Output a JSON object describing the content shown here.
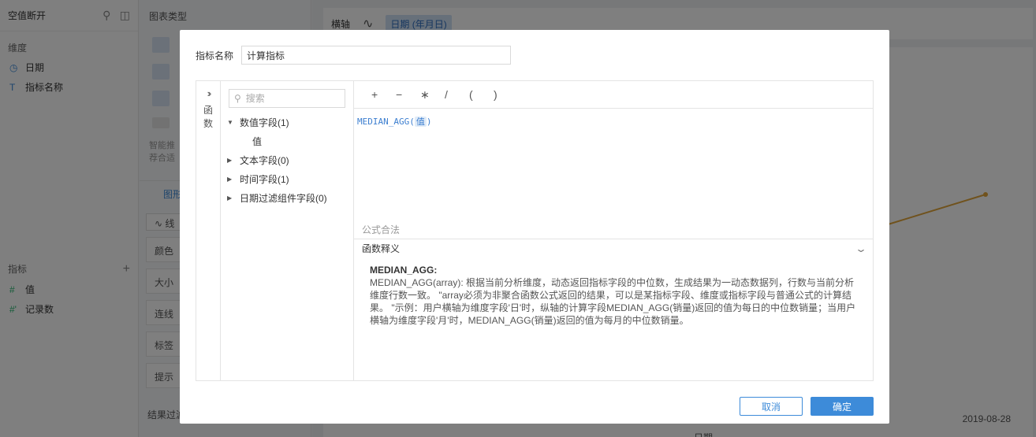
{
  "left_panel": {
    "title": "空值断开",
    "dimension_label": "维度",
    "dimensions": [
      {
        "icon": "clock-icon",
        "label": "日期"
      },
      {
        "icon": "text-type-icon",
        "label": "指标名称"
      }
    ],
    "metric_label": "指标",
    "metrics": [
      {
        "icon": "number-type-icon",
        "label": "值"
      },
      {
        "icon": "count-type-icon",
        "label": "记录数"
      }
    ]
  },
  "mid_panel": {
    "title": "图表类型",
    "smart_text_1": "智能推",
    "smart_text_2": "荐合适",
    "tab_label": "图形",
    "line_label": "线",
    "props": [
      "颜色",
      "大小",
      "连线",
      "标签",
      "提示"
    ],
    "filter_label": "结果过滤"
  },
  "main": {
    "axis_label": "横轴",
    "axis_chip": "日期 (年月日)",
    "date_tick": "2019-08-28",
    "x_title": "日期"
  },
  "modal": {
    "name_label": "指标名称",
    "name_value": "计算指标",
    "fn_label_1": "函",
    "fn_label_2": "数",
    "search_placeholder": "搜索",
    "tree": [
      {
        "label": "数值字段(1)",
        "expanded": true,
        "children": [
          "值"
        ]
      },
      {
        "label": "文本字段(0)",
        "expanded": false
      },
      {
        "label": "时间字段(1)",
        "expanded": false
      },
      {
        "label": "日期过滤组件字段(0)",
        "expanded": false
      }
    ],
    "operators": [
      "+",
      "−",
      "∗",
      "/",
      "(",
      ")"
    ],
    "formula_fn": "MEDIAN_AGG(",
    "formula_arg": "值",
    "formula_close": ")",
    "valid_text": "公式合法",
    "explain_label": "函数释义",
    "explain_title": "MEDIAN_AGG:",
    "explain_body": "MEDIAN_AGG(array): 根据当前分析维度，动态返回指标字段的中位数，生成结果为一动态数据列，行数与当前分析维度行数一致。 \"array必须为非聚合函数公式返回的结果，可以是某指标字段、维度或指标字段与普通公式的计算结果。 \"示例：用户横轴为维度字段'日'时，纵轴的计算字段MEDIAN_AGG(销量)返回的值为每日的中位数销量；当用户横轴为维度字段'月'时，MEDIAN_AGG(销量)返回的值为每月的中位数销量。",
    "cancel_label": "取消",
    "ok_label": "确定"
  },
  "colors": {
    "accent": "#3d8bd9",
    "series": "#e0a53a"
  }
}
